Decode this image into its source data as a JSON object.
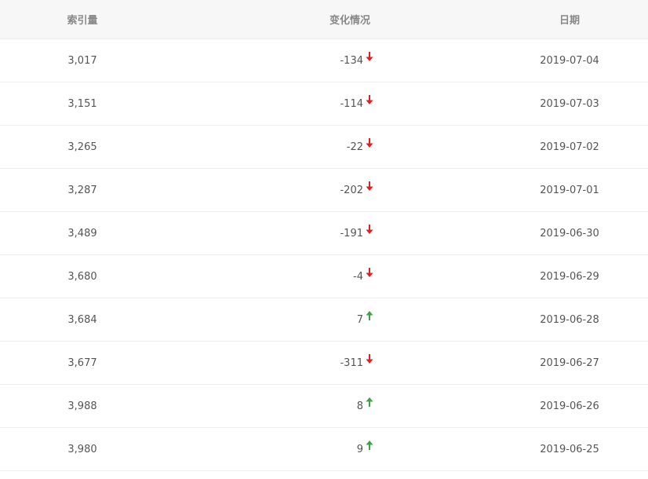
{
  "table": {
    "headers": [
      "索引量",
      "变化情况",
      "日期"
    ],
    "colors": {
      "down": "#e02020",
      "up": "#3fa048"
    },
    "rows": [
      {
        "index": "3,017",
        "change": "-134",
        "direction": "down",
        "arrow_icon": "arrow-down-icon",
        "date": "2019-07-04"
      },
      {
        "index": "3,151",
        "change": "-114",
        "direction": "down",
        "arrow_icon": "arrow-down-icon",
        "date": "2019-07-03"
      },
      {
        "index": "3,265",
        "change": "-22",
        "direction": "down",
        "arrow_icon": "arrow-down-icon",
        "date": "2019-07-02"
      },
      {
        "index": "3,287",
        "change": "-202",
        "direction": "down",
        "arrow_icon": "arrow-down-icon",
        "date": "2019-07-01"
      },
      {
        "index": "3,489",
        "change": "-191",
        "direction": "down",
        "arrow_icon": "arrow-down-icon",
        "date": "2019-06-30"
      },
      {
        "index": "3,680",
        "change": "-4",
        "direction": "down",
        "arrow_icon": "arrow-down-icon",
        "date": "2019-06-29"
      },
      {
        "index": "3,684",
        "change": "7",
        "direction": "up",
        "arrow_icon": "arrow-up-icon",
        "date": "2019-06-28"
      },
      {
        "index": "3,677",
        "change": "-311",
        "direction": "down",
        "arrow_icon": "arrow-down-icon",
        "date": "2019-06-27"
      },
      {
        "index": "3,988",
        "change": "8",
        "direction": "up",
        "arrow_icon": "arrow-up-icon",
        "date": "2019-06-26"
      },
      {
        "index": "3,980",
        "change": "9",
        "direction": "up",
        "arrow_icon": "arrow-up-icon",
        "date": "2019-06-25"
      }
    ]
  }
}
